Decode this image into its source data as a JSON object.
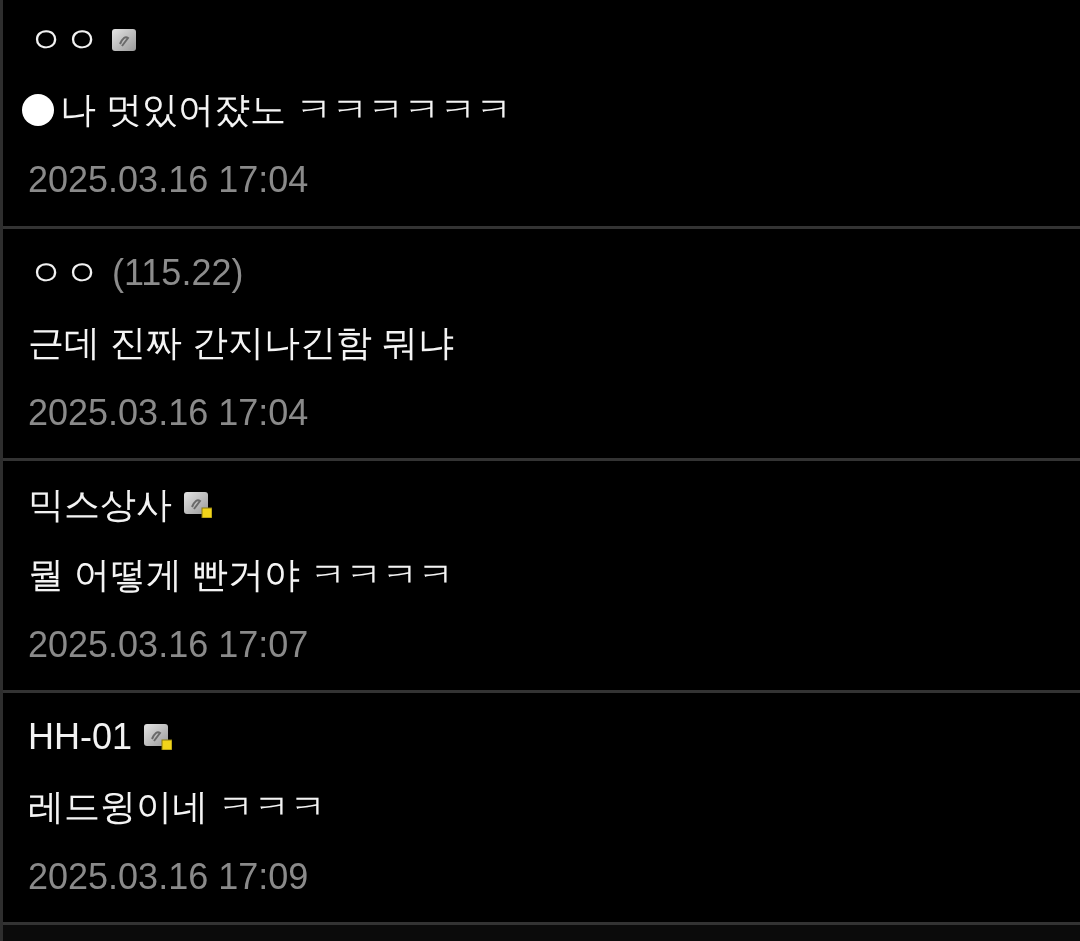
{
  "comments": [
    {
      "author": "ㅇㅇ",
      "kind": "badge",
      "touch_dot": true,
      "text": "나 멋있어쟜노 ㅋㅋㅋㅋㅋㅋ",
      "time": "2025.03.16 17:04"
    },
    {
      "author": "ㅇㅇ",
      "kind": "ip",
      "ip": "(115.22)",
      "touch_dot": false,
      "text": "근데 진짜 간지나긴함 뭐냐",
      "time": "2025.03.16 17:04"
    },
    {
      "author": "믹스상사",
      "kind": "flagged",
      "touch_dot": false,
      "text": "뭘 어떻게 빤거야 ㅋㅋㅋㅋ",
      "time": "2025.03.16 17:07"
    },
    {
      "author": "HH-01",
      "kind": "flagged",
      "touch_dot": false,
      "text": "레드윙이네 ㅋㅋㅋ",
      "time": "2025.03.16 17:09"
    }
  ]
}
